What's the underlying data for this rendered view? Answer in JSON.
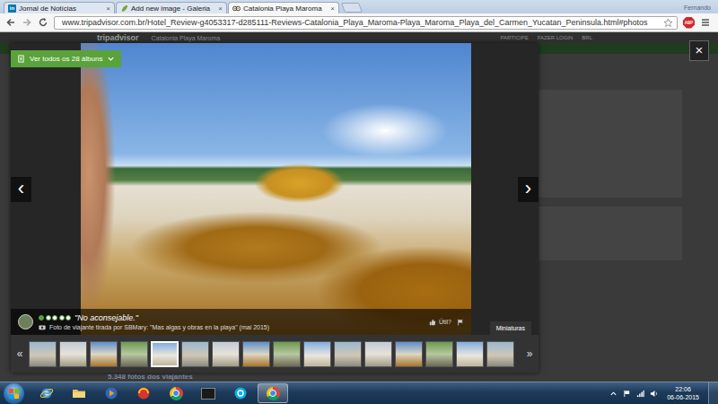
{
  "browser": {
    "tabs": [
      {
        "label": "Jornal de Notícias",
        "kind": "linkedin",
        "icon_text": "in",
        "selected": false
      },
      {
        "label": "Add new image - Galeria",
        "kind": "galeria",
        "icon_text": "",
        "selected": false
      },
      {
        "label": "Catalonia Playa Maroma",
        "kind": "tripadvisor",
        "icon_text": "",
        "selected": true
      }
    ],
    "tab_close": "×",
    "profile": "Fernando",
    "url": "www.tripadvisor.com.br/Hotel_Review-g4053317-d285111-Reviews-Catalonia_Playa_Maroma-Playa_Maroma_Playa_del_Carmen_Yucatan_Peninsula.html#photos",
    "abp": "ABP"
  },
  "page": {
    "logo": "tripadvisor",
    "hotel": "Catalonia Playa Maroma",
    "links": [
      "PARTICIPE",
      "FAZER LOGIN",
      "BRL"
    ],
    "photo_count": "5.348 fotos dos viajantes"
  },
  "lightbox": {
    "albums_button": "Ver todos os 28 álbuns",
    "close": "×",
    "prev": "‹",
    "next": "›",
    "review": {
      "stars": 1,
      "out_of": 5,
      "title": "\"No aconsejable.\"",
      "caption": "Foto de viajante tirada por SBMary: \"Mas algas y obras en la playa\" (mai 2015)",
      "helpful": "Útil?"
    },
    "thumbnails_tab": "Miniaturas",
    "thumbs_prev": "«",
    "thumbs_next": "»",
    "thumbnails": [
      {
        "selected": false
      },
      {
        "selected": false
      },
      {
        "selected": false
      },
      {
        "selected": false
      },
      {
        "selected": true
      },
      {
        "selected": false
      },
      {
        "selected": false
      },
      {
        "selected": false
      },
      {
        "selected": false
      },
      {
        "selected": false
      },
      {
        "selected": false
      },
      {
        "selected": false
      },
      {
        "selected": false
      },
      {
        "selected": false
      },
      {
        "selected": false
      },
      {
        "selected": false
      }
    ]
  },
  "taskbar": {
    "time": "22:06",
    "date": "06-06-2015"
  }
}
